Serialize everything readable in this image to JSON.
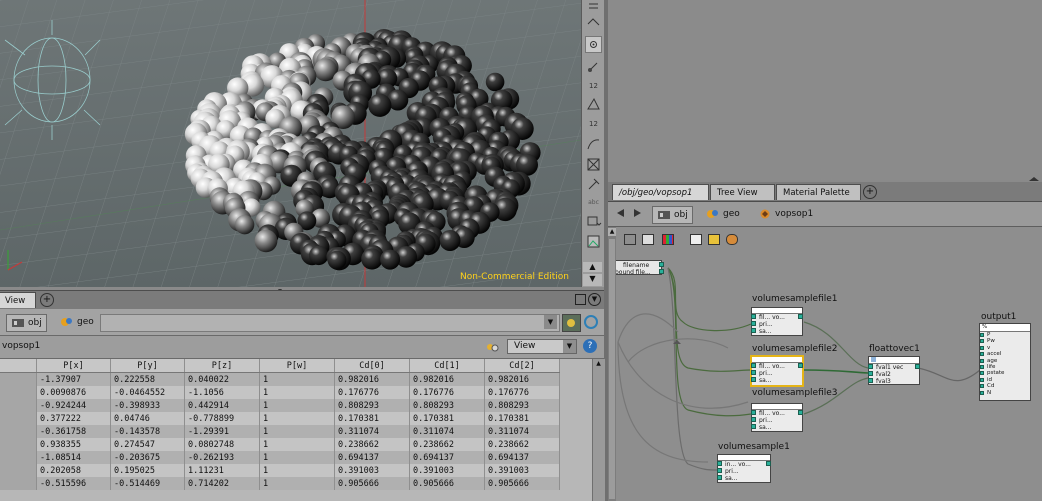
{
  "viewport": {
    "watermark": "Non-Commercial Edition",
    "ortho_label_y": "y"
  },
  "vshelf": {
    "labels": [
      "12",
      "12",
      "abc"
    ]
  },
  "right_tabs": [
    {
      "label": "/obj/geo/vopsop1",
      "close": "×"
    },
    {
      "label": "Tree View",
      "close": "×"
    },
    {
      "label": "Material Palette",
      "close": "×"
    }
  ],
  "right_path": {
    "items": [
      "obj",
      "geo",
      "vopsop1"
    ]
  },
  "sheet_tabs": {
    "label": "View",
    "close": "×"
  },
  "sheet_path": {
    "items": [
      "obj",
      "geo"
    ]
  },
  "sheet_node": {
    "name": "vopsop1",
    "view_select": "View"
  },
  "columns": [
    "P[x]",
    "P[y]",
    "P[z]",
    "P[w]",
    "Cd[0]",
    "Cd[1]",
    "Cd[2]"
  ],
  "rows": [
    [
      "-1.37907",
      "0.222558",
      "0.040022",
      "1",
      "0.982016",
      "0.982016",
      "0.982016"
    ],
    [
      "0.0090876",
      "-0.0464552",
      "-1.1056",
      "1",
      "0.176776",
      "0.176776",
      "0.176776"
    ],
    [
      "-0.924244",
      "-0.398933",
      "0.442914",
      "1",
      "0.808293",
      "0.808293",
      "0.808293"
    ],
    [
      "0.377222",
      "0.04746",
      "-0.778899",
      "1",
      "0.170381",
      "0.170381",
      "0.170381"
    ],
    [
      "-0.361758",
      "-0.143578",
      "-1.29391",
      "1",
      "0.311074",
      "0.311074",
      "0.311074"
    ],
    [
      "0.938355",
      "0.274547",
      "0.0802748",
      "1",
      "0.238662",
      "0.238662",
      "0.238662"
    ],
    [
      "-1.08514",
      "-0.203675",
      "-0.262193",
      "1",
      "0.694137",
      "0.694137",
      "0.694137"
    ],
    [
      "0.202058",
      "0.195025",
      "1.11231",
      "1",
      "0.391003",
      "0.391003",
      "0.391003"
    ],
    [
      "-0.515596",
      "-0.514469",
      "0.714202",
      "1",
      "0.905666",
      "0.905666",
      "0.905666"
    ]
  ],
  "network": {
    "input_node": {
      "ports": [
        "filename",
        "bound file..."
      ]
    },
    "nodes": [
      {
        "title": "volumesamplefile1",
        "rows": [
          "fil...   vo...",
          "pri...",
          "sa..."
        ]
      },
      {
        "title": "volumesamplefile2",
        "rows": [
          "fil...   vo...",
          "pri...",
          "sa..."
        ]
      },
      {
        "title": "volumesamplefile3",
        "rows": [
          "fil...   vo...",
          "pri...",
          "sa..."
        ]
      },
      {
        "title": "volumesample1",
        "rows": [
          "in...   vo...",
          "pri...",
          "sa..."
        ]
      },
      {
        "title": "floattovec1",
        "rows": [
          "fval1     vec",
          "fval2",
          "fval3"
        ]
      },
      {
        "title": "output1",
        "rows": [
          "P",
          "Pw",
          "v",
          "accel",
          "age",
          "life",
          "pstate",
          "id",
          "Cd",
          "N"
        ]
      }
    ]
  }
}
